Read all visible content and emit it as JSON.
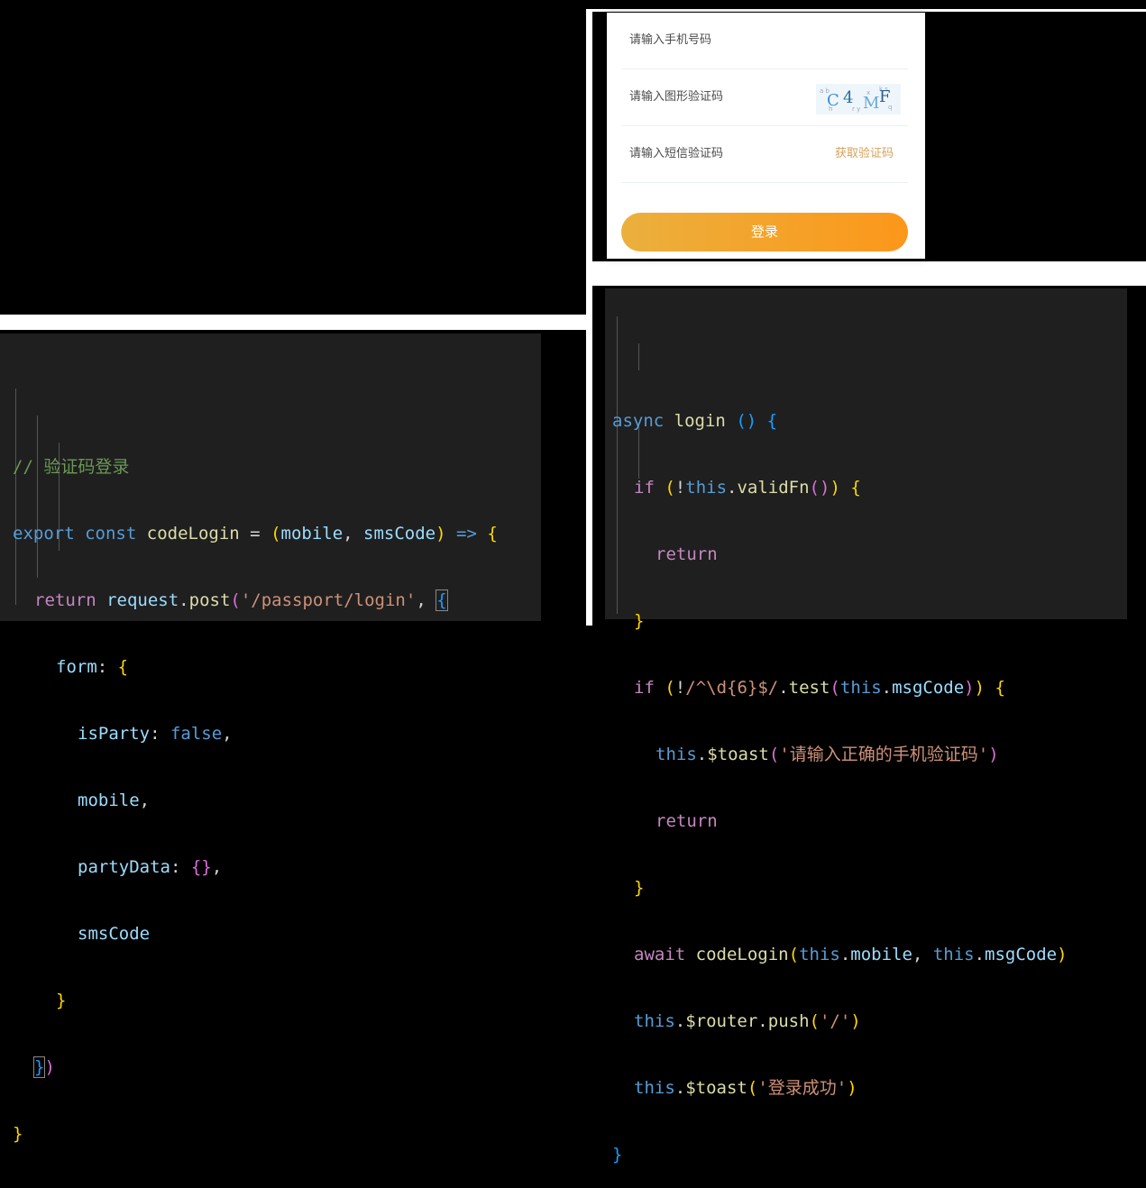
{
  "form": {
    "phone_placeholder": "请输入手机号码",
    "captcha_placeholder": "请输入图形验证码",
    "captcha_text": "C4MF",
    "sms_placeholder": "请输入短信验证码",
    "get_code_label": "获取验证码",
    "login_button": "登录"
  },
  "code_api": {
    "lines": [
      "// 验证码登录",
      "export const codeLogin = (mobile, smsCode) => {",
      "return request.post('/passport/login', {",
      "form: {",
      "isParty: false,",
      "mobile,",
      "partyData: {},",
      "smsCode",
      "}",
      "})",
      "}"
    ]
  },
  "code_login": {
    "lines": [
      "async login () {",
      "if (!this.validFn()) {",
      "return",
      "}",
      "if (!/^\\d{6}$/.test(this.msgCode)) {",
      "this.$toast('请输入正确的手机验证码')",
      "return",
      "}",
      "await codeLogin(this.mobile, this.msgCode)",
      "this.$router.push('/')",
      "this.$toast('登录成功')",
      "}"
    ]
  },
  "colors": {
    "code_bg": "#1f1f1f",
    "keyword": "#569cd6",
    "string": "#ce9178",
    "comment": "#6a9955",
    "button_start": "#ebb03d",
    "button_end": "#fc971a"
  }
}
